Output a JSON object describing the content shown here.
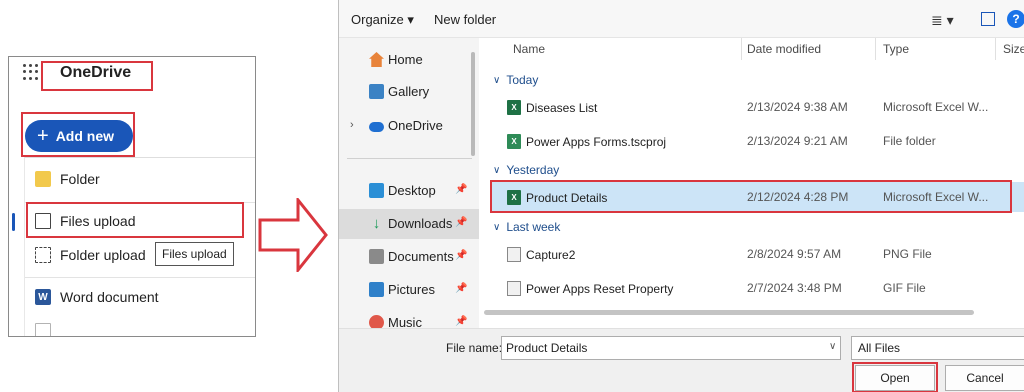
{
  "onedrive": {
    "title": "OneDrive",
    "add_new": "Add new",
    "menu": [
      {
        "label": "Folder",
        "icon": "folder-icon"
      },
      {
        "label": "Files upload",
        "icon": "file-upload-icon"
      },
      {
        "label": "Folder upload",
        "icon": "folder-upload-icon"
      },
      {
        "label": "Word document",
        "icon": "word-icon"
      }
    ],
    "tooltip": "Files upload"
  },
  "dialog": {
    "toolbar": {
      "organize": "Organize",
      "new_folder": "New folder"
    },
    "nav": [
      {
        "label": "Home",
        "icon": "home-icon"
      },
      {
        "label": "Gallery",
        "icon": "gallery-icon"
      },
      {
        "label": "OneDrive",
        "icon": "cloud-icon"
      },
      {
        "label": "Desktop",
        "icon": "desktop-icon"
      },
      {
        "label": "Downloads",
        "icon": "download-icon"
      },
      {
        "label": "Documents",
        "icon": "documents-icon"
      },
      {
        "label": "Pictures",
        "icon": "pictures-icon"
      },
      {
        "label": "Music",
        "icon": "music-icon"
      }
    ],
    "columns": {
      "name": "Name",
      "date": "Date modified",
      "type": "Type",
      "size": "Size"
    },
    "groups": [
      {
        "label": "Today",
        "files": [
          {
            "name": "Diseases List",
            "date": "2/13/2024 9:38 AM",
            "type": "Microsoft Excel W...",
            "icon": "excel-icon"
          },
          {
            "name": "Power Apps Forms.tscproj",
            "date": "2/13/2024 9:21 AM",
            "type": "File folder",
            "icon": "project-icon"
          }
        ]
      },
      {
        "label": "Yesterday",
        "files": [
          {
            "name": "Product Details",
            "date": "2/12/2024 4:28 PM",
            "type": "Microsoft Excel W...",
            "icon": "excel-icon"
          }
        ]
      },
      {
        "label": "Last week",
        "files": [
          {
            "name": "Capture2",
            "date": "2/8/2024 9:57 AM",
            "type": "PNG File",
            "icon": "image-icon"
          },
          {
            "name": "Power Apps Reset Property",
            "date": "2/7/2024 3:48 PM",
            "type": "GIF File",
            "icon": "image-icon"
          }
        ]
      }
    ],
    "file_name_label": "File name:",
    "file_name_value": "Product Details",
    "file_type": "All Files",
    "open": "Open",
    "cancel": "Cancel"
  },
  "colors": {
    "accent": "#1a56b8",
    "highlight": "#d9363e",
    "selection": "#cce4f7"
  }
}
